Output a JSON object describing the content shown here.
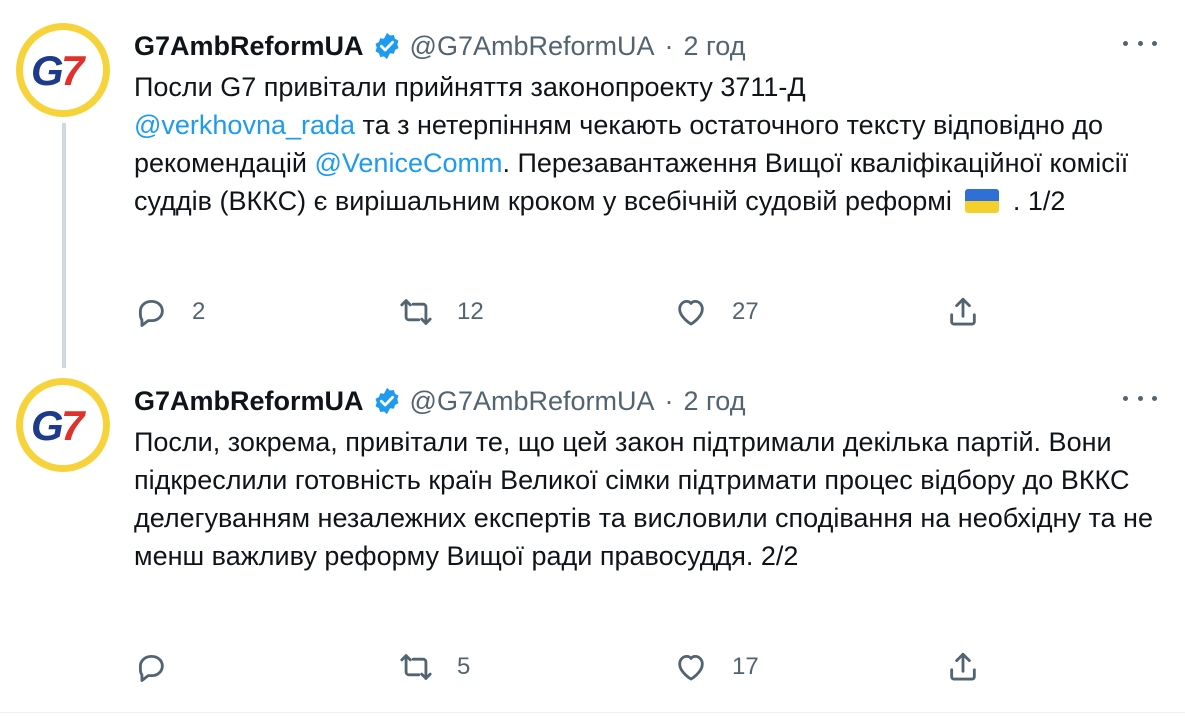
{
  "colors": {
    "accent": "#1d9bf0",
    "secondary_text": "#536471",
    "verified": "#1d9bf0",
    "avatar_ring": "#f7d33b",
    "logo_blue": "#1e3a8a",
    "logo_red": "#e0322b"
  },
  "tweets": [
    {
      "author": {
        "name": "G7AmbReformUA",
        "handle": "@G7AmbReformUA",
        "avatar_text": "G7"
      },
      "separator": "·",
      "time": "2 год",
      "body": {
        "line1": "Посли G7 привітали прийняття законопроекту 3711-Д",
        "mention1": "@verkhovna_rada",
        "line2": " та з нетерпінням чекають остаточного тексту відповідно до рекомендацій ",
        "mention2": "@VeniceComm",
        "line3": ". Перезавантаження Вищої кваліфікаційної комісії суддів (ВККС) є вирішальним кроком у всебічній судовій реформі ",
        "flag_icon": "ukraine-flag-emoji",
        "line4": " . 1/2"
      },
      "actions": {
        "replies": "2",
        "retweets": "12",
        "likes": "27"
      }
    },
    {
      "author": {
        "name": "G7AmbReformUA",
        "handle": "@G7AmbReformUA",
        "avatar_text": "G7"
      },
      "separator": "·",
      "time": "2 год",
      "body": {
        "text": "Посли, зокрема, привітали те, що цей закон підтримали декілька партій. Вони підкреслили готовність країн Великої сімки підтримати процес відбору до ВККС делегуванням незалежних експертів та висловили сподівання на необхідну та не менш важливу реформу Вищої ради правосуддя. 2/2"
      },
      "actions": {
        "replies": "",
        "retweets": "5",
        "likes": "17"
      }
    }
  ],
  "icons": [
    "verified-badge-icon",
    "more-options-icon",
    "reply-icon",
    "retweet-icon",
    "like-icon",
    "share-icon"
  ]
}
